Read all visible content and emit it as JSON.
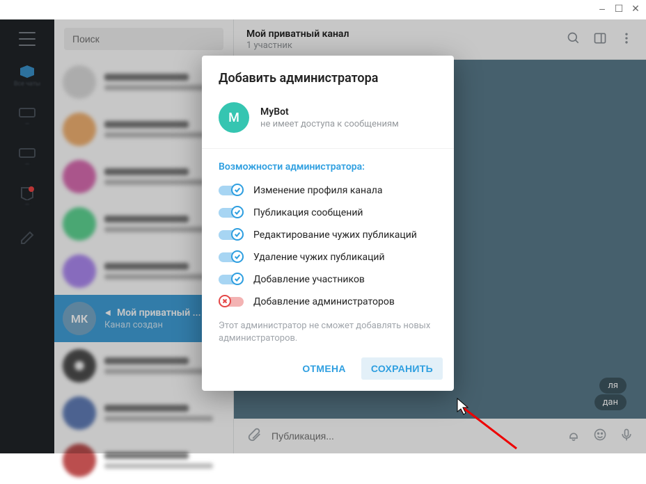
{
  "window_controls": {
    "min": "_",
    "max": "☐",
    "close": "✕"
  },
  "search": {
    "placeholder": "Поиск"
  },
  "nav_active_label": "Все чаты",
  "selected_chat": {
    "avatar_initials": "МК",
    "title": "Мой приватный ...",
    "subtitle": "Канал создан"
  },
  "header": {
    "title": "Мой приватный канал",
    "subtitle": "1 участник"
  },
  "body_pills": {
    "date": "ля",
    "status": "дан"
  },
  "composer": {
    "placeholder": "Публикация..."
  },
  "modal": {
    "title": "Добавить администратора",
    "bot": {
      "initial": "M",
      "name": "MyBot",
      "subtitle": "не имеет доступа к сообщениям"
    },
    "section_title": "Возможности администратора:",
    "permissions": {
      "p0": {
        "label": "Изменение профиля канала",
        "on": true
      },
      "p1": {
        "label": "Публикация сообщений",
        "on": true
      },
      "p2": {
        "label": "Редактирование чужих публикаций",
        "on": true
      },
      "p3": {
        "label": "Удаление чужих публикаций",
        "on": true
      },
      "p4": {
        "label": "Добавление участников",
        "on": true
      },
      "p5": {
        "label": "Добавление администраторов",
        "on": false
      }
    },
    "note": "Этот администратор не сможет добавлять новых администраторов.",
    "cancel": "ОТМЕНА",
    "save": "СОХРАНИТЬ"
  },
  "chat_avatar_colors": [
    "#d5d5d5",
    "#f0a050",
    "#d24aa0",
    "#38cc7a",
    "#9b6ef0",
    "#477fca",
    "#222",
    "#3b5fa8",
    "#aa2222",
    "#d5d5d5"
  ]
}
